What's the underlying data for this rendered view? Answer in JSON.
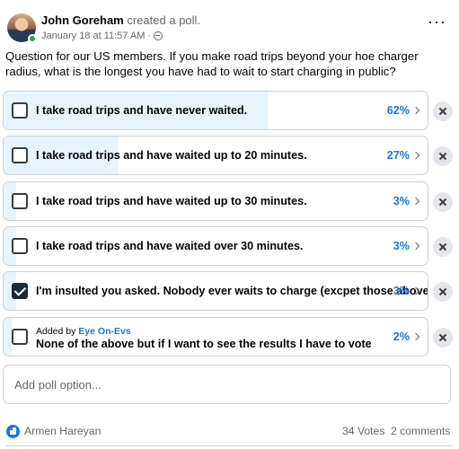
{
  "post": {
    "author": "John Goreham",
    "action": "created a poll.",
    "timestamp": "January 18 at 11:57 AM",
    "separator": "·",
    "more_label": "···",
    "question": "Question for our US members. If you make road trips beyond your hoe charger radius, what is the longest you have had to wait to start charging in public?"
  },
  "poll": {
    "options": [
      {
        "text": "I take road trips and have never waited.",
        "percent_label": "62%",
        "percent": 62,
        "checked": false
      },
      {
        "text": "I take road trips and have waited up to 20 minutes.",
        "percent_label": "27%",
        "percent": 27,
        "checked": false
      },
      {
        "text": "I take road trips and have waited up to 30 minutes.",
        "percent_label": "3%",
        "percent": 3,
        "checked": false
      },
      {
        "text": "I take road trips and have waited over 30 minutes.",
        "percent_label": "3%",
        "percent": 3,
        "checked": false
      },
      {
        "text": "I'm insulted you asked. Nobody ever waits to charge (excpet those above)",
        "percent_label": "3%",
        "percent": 3,
        "checked": true
      },
      {
        "added_by_prefix": "Added by",
        "added_by": "Eye On-Evs",
        "text": "None of the above but if I want to see the results I have to vote",
        "percent_label": "2%",
        "percent": 2,
        "checked": false
      }
    ],
    "add_option_placeholder": "Add poll option..."
  },
  "footer": {
    "reactor": "Armen Hareyan",
    "votes": "34 Votes",
    "comments": "2 comments"
  },
  "colors": {
    "accent": "#1b74e4",
    "fill": "#e7f3ff",
    "border": "#ced0d4",
    "secondary_text": "#65676b"
  }
}
